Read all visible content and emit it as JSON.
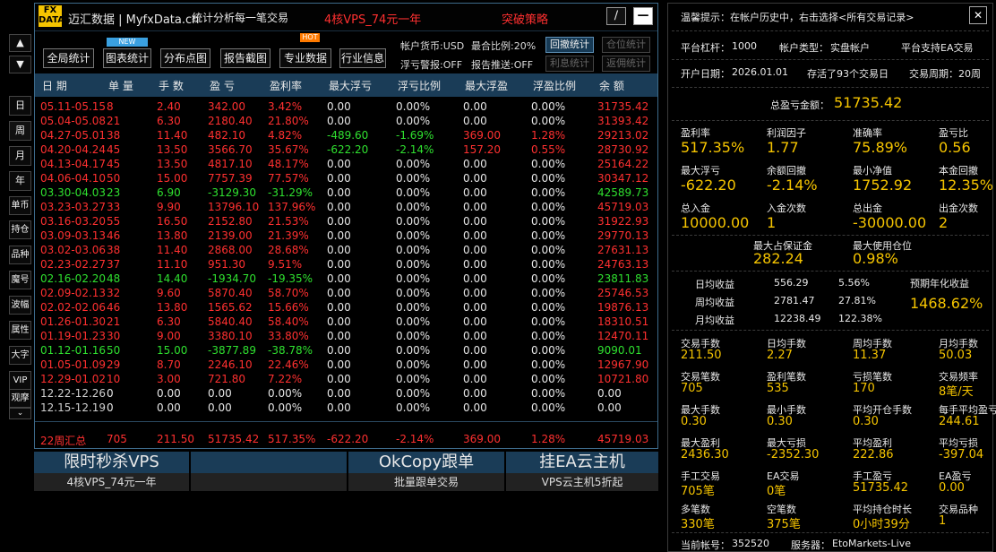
{
  "side_tabs": [
    "日",
    "周",
    "月",
    "年",
    "单币",
    "持仓",
    "品种",
    "魔号",
    "波幅",
    "属性",
    "大字",
    "VIP",
    "观摩"
  ],
  "side_arrows": {
    "up": "▲",
    "down": "▼",
    "small_down": "⌄"
  },
  "window": {
    "logo_top": "FX",
    "logo_bottom": "DATA",
    "title": "迈汇数据 | MyfxData.cn",
    "subtitle": "统计分析每一笔交易",
    "promo_text": "4核VPS_74元一年",
    "strategy": "突破策略",
    "btn_edit": "∕",
    "btn_min": "—"
  },
  "toolbar": {
    "buttons": [
      "全局统计",
      "图表统计",
      "分布点图",
      "报告截图",
      "专业数据",
      "行业信息"
    ],
    "new_badge": "NEW",
    "hot_badge": "HOT",
    "info": [
      "帐户货币:USD",
      "最合比例:20%",
      "浮亏警报:OFF",
      "报告推送:OFF"
    ],
    "right_buttons": [
      "回撤统计",
      "仓位统计",
      "利息统计",
      "返佣统计"
    ]
  },
  "table": {
    "headers": [
      "日 期",
      "单 量",
      "手 数",
      "盈 亏",
      "盈利率",
      "最大浮亏",
      "浮亏比例",
      "最大浮盈",
      "浮盈比例",
      "余 额"
    ],
    "rows": [
      {
        "c": "red",
        "v": [
          "05.11-05.15",
          "8",
          "2.40",
          "342.00",
          "3.42%",
          "0.00",
          "0.00%",
          "0.00",
          "0.00%",
          "31735.42"
        ]
      },
      {
        "c": "red",
        "v": [
          "05.04-05.08",
          "21",
          "6.30",
          "2180.40",
          "21.80%",
          "0.00",
          "0.00%",
          "0.00",
          "0.00%",
          "31393.42"
        ]
      },
      {
        "c": "red",
        "v": [
          "04.27-05.01",
          "38",
          "11.40",
          "482.10",
          "4.82%",
          "-489.60",
          "-1.69%",
          "369.00",
          "1.28%",
          "29213.02"
        ]
      },
      {
        "c": "red",
        "v": [
          "04.20-04.24",
          "45",
          "13.50",
          "3566.70",
          "35.67%",
          "-622.20",
          "-2.14%",
          "157.20",
          "0.55%",
          "28730.92"
        ]
      },
      {
        "c": "red",
        "v": [
          "04.13-04.17",
          "45",
          "13.50",
          "4817.10",
          "48.17%",
          "0.00",
          "0.00%",
          "0.00",
          "0.00%",
          "25164.22"
        ]
      },
      {
        "c": "red",
        "v": [
          "04.06-04.10",
          "50",
          "15.00",
          "7757.39",
          "77.57%",
          "0.00",
          "0.00%",
          "0.00",
          "0.00%",
          "30347.12"
        ]
      },
      {
        "c": "green",
        "v": [
          "03.30-04.03",
          "23",
          "6.90",
          "-3129.30",
          "-31.29%",
          "0.00",
          "0.00%",
          "0.00",
          "0.00%",
          "42589.73"
        ]
      },
      {
        "c": "red",
        "v": [
          "03.23-03.27",
          "33",
          "9.90",
          "13796.10",
          "137.96%",
          "0.00",
          "0.00%",
          "0.00",
          "0.00%",
          "45719.03"
        ]
      },
      {
        "c": "red",
        "v": [
          "03.16-03.20",
          "55",
          "16.50",
          "2152.80",
          "21.53%",
          "0.00",
          "0.00%",
          "0.00",
          "0.00%",
          "31922.93"
        ]
      },
      {
        "c": "red",
        "v": [
          "03.09-03.13",
          "46",
          "13.80",
          "2139.00",
          "21.39%",
          "0.00",
          "0.00%",
          "0.00",
          "0.00%",
          "29770.13"
        ]
      },
      {
        "c": "red",
        "v": [
          "03.02-03.06",
          "38",
          "11.40",
          "2868.00",
          "28.68%",
          "0.00",
          "0.00%",
          "0.00",
          "0.00%",
          "27631.13"
        ]
      },
      {
        "c": "red",
        "v": [
          "02.23-02.27",
          "37",
          "11.10",
          "951.30",
          "9.51%",
          "0.00",
          "0.00%",
          "0.00",
          "0.00%",
          "24763.13"
        ]
      },
      {
        "c": "green",
        "v": [
          "02.16-02.20",
          "48",
          "14.40",
          "-1934.70",
          "-19.35%",
          "0.00",
          "0.00%",
          "0.00",
          "0.00%",
          "23811.83"
        ]
      },
      {
        "c": "red",
        "v": [
          "02.09-02.13",
          "32",
          "9.60",
          "5870.40",
          "58.70%",
          "0.00",
          "0.00%",
          "0.00",
          "0.00%",
          "25746.53"
        ]
      },
      {
        "c": "red",
        "v": [
          "02.02-02.06",
          "46",
          "13.80",
          "1565.62",
          "15.66%",
          "0.00",
          "0.00%",
          "0.00",
          "0.00%",
          "19876.13"
        ]
      },
      {
        "c": "red",
        "v": [
          "01.26-01.30",
          "21",
          "6.30",
          "5840.40",
          "58.40%",
          "0.00",
          "0.00%",
          "0.00",
          "0.00%",
          "18310.51"
        ]
      },
      {
        "c": "red",
        "v": [
          "01.19-01.23",
          "30",
          "9.00",
          "3380.10",
          "33.80%",
          "0.00",
          "0.00%",
          "0.00",
          "0.00%",
          "12470.11"
        ]
      },
      {
        "c": "green",
        "v": [
          "01.12-01.16",
          "50",
          "15.00",
          "-3877.89",
          "-38.78%",
          "0.00",
          "0.00%",
          "0.00",
          "0.00%",
          "9090.01"
        ]
      },
      {
        "c": "red",
        "v": [
          "01.05-01.09",
          "29",
          "8.70",
          "2246.10",
          "22.46%",
          "0.00",
          "0.00%",
          "0.00",
          "0.00%",
          "12967.90"
        ]
      },
      {
        "c": "red",
        "v": [
          "12.29-01.02",
          "10",
          "3.00",
          "721.80",
          "7.22%",
          "0.00",
          "0.00%",
          "0.00",
          "0.00%",
          "10721.80"
        ]
      },
      {
        "c": "gray",
        "v": [
          "12.22-12.26",
          "0",
          "0.00",
          "0.00",
          "0.00%",
          "0.00",
          "0.00%",
          "0.00",
          "0.00%",
          "0.00"
        ]
      },
      {
        "c": "gray",
        "v": [
          "12.15-12.19",
          "0",
          "0.00",
          "0.00",
          "0.00%",
          "0.00",
          "0.00%",
          "0.00",
          "0.00%",
          "0.00"
        ]
      }
    ],
    "summary": [
      "22周汇总",
      "705",
      "211.50",
      "51735.42",
      "517.35%",
      "-622.20",
      "-2.14%",
      "369.00",
      "1.28%",
      "45719.03"
    ]
  },
  "promos": [
    {
      "top": "限时秒杀VPS",
      "bottom": "4核VPS_74元一年"
    },
    {
      "top": "",
      "bottom": ""
    },
    {
      "top": "OkCopy跟单",
      "bottom": "批量跟单交易"
    },
    {
      "top": "挂EA云主机",
      "bottom": "VPS云主机5折起"
    }
  ],
  "panel": {
    "tip": "温馨提示：在帐户历史中，右击选择<所有交易记录>",
    "close": "✕",
    "row1": [
      "平台杠杆：",
      "1000",
      "帐户类型：",
      "实盘帐户",
      "平台支持EA交易"
    ],
    "row2": [
      "开户日期：",
      "2026.01.01",
      "存活了93个交易日",
      "交易周期：",
      "20周"
    ],
    "total_label": "总盈亏金额：",
    "total_value": "51735.42",
    "grid1": [
      {
        "l": "盈利率",
        "v": "517.35%"
      },
      {
        "l": "利润因子",
        "v": "1.77"
      },
      {
        "l": "准确率",
        "v": "75.89%"
      },
      {
        "l": "盈亏比",
        "v": "0.56"
      },
      {
        "l": "最大浮亏",
        "v": "-622.20"
      },
      {
        "l": "余额回撤",
        "v": "-2.14%"
      },
      {
        "l": "最小净值",
        "v": "1752.92"
      },
      {
        "l": "本金回撤",
        "v": "12.35%"
      },
      {
        "l": "总入金",
        "v": "10000.00"
      },
      {
        "l": "入金次数",
        "v": "1"
      },
      {
        "l": "总出金",
        "v": "-30000.00"
      },
      {
        "l": "出金次数",
        "v": "2"
      }
    ],
    "margin": [
      {
        "l": "最大占保证金",
        "v": "282.24"
      },
      {
        "l": "最大使用仓位",
        "v": "0.98%"
      }
    ],
    "avg": [
      {
        "l": "日均收益",
        "a": "556.29",
        "b": "5.56%"
      },
      {
        "l": "周均收益",
        "a": "2781.47",
        "b": "27.81%"
      },
      {
        "l": "月均收益",
        "a": "12238.49",
        "b": "122.38%"
      }
    ],
    "annual_label": "预期年化收益",
    "annual_value": "1468.62%",
    "grid2": [
      {
        "l": "交易手数",
        "v": "211.50"
      },
      {
        "l": "日均手数",
        "v": "2.27"
      },
      {
        "l": "周均手数",
        "v": "11.37"
      },
      {
        "l": "月均手数",
        "v": "50.03"
      },
      {
        "l": "交易笔数",
        "v": "705"
      },
      {
        "l": "盈利笔数",
        "v": "535"
      },
      {
        "l": "亏损笔数",
        "v": "170"
      },
      {
        "l": "交易频率",
        "v": "8笔/天"
      },
      {
        "l": "最大手数",
        "v": "0.30"
      },
      {
        "l": "最小手数",
        "v": "0.30"
      },
      {
        "l": "平均开仓手数",
        "v": "0.30"
      },
      {
        "l": "每手平均盈亏",
        "v": "244.61"
      },
      {
        "l": "最大盈利",
        "v": "2436.30"
      },
      {
        "l": "最大亏损",
        "v": "-2352.30"
      },
      {
        "l": "平均盈利",
        "v": "222.86"
      },
      {
        "l": "平均亏损",
        "v": "-397.04"
      },
      {
        "l": "手工交易",
        "v": "705笔"
      },
      {
        "l": "EA交易",
        "v": "0笔"
      },
      {
        "l": "手工盈亏",
        "v": "51735.42"
      },
      {
        "l": "EA盈亏",
        "v": "0.00"
      },
      {
        "l": "多笔数",
        "v": "330笔"
      },
      {
        "l": "空笔数",
        "v": "375笔"
      },
      {
        "l": "平均持仓时长",
        "v": "0小时39分"
      },
      {
        "l": "交易品种",
        "v": "1"
      }
    ],
    "account_label": "当前帐号：",
    "account_value": "352520",
    "server_label": "服务器：",
    "server_value": "EtoMarkets-Live"
  }
}
